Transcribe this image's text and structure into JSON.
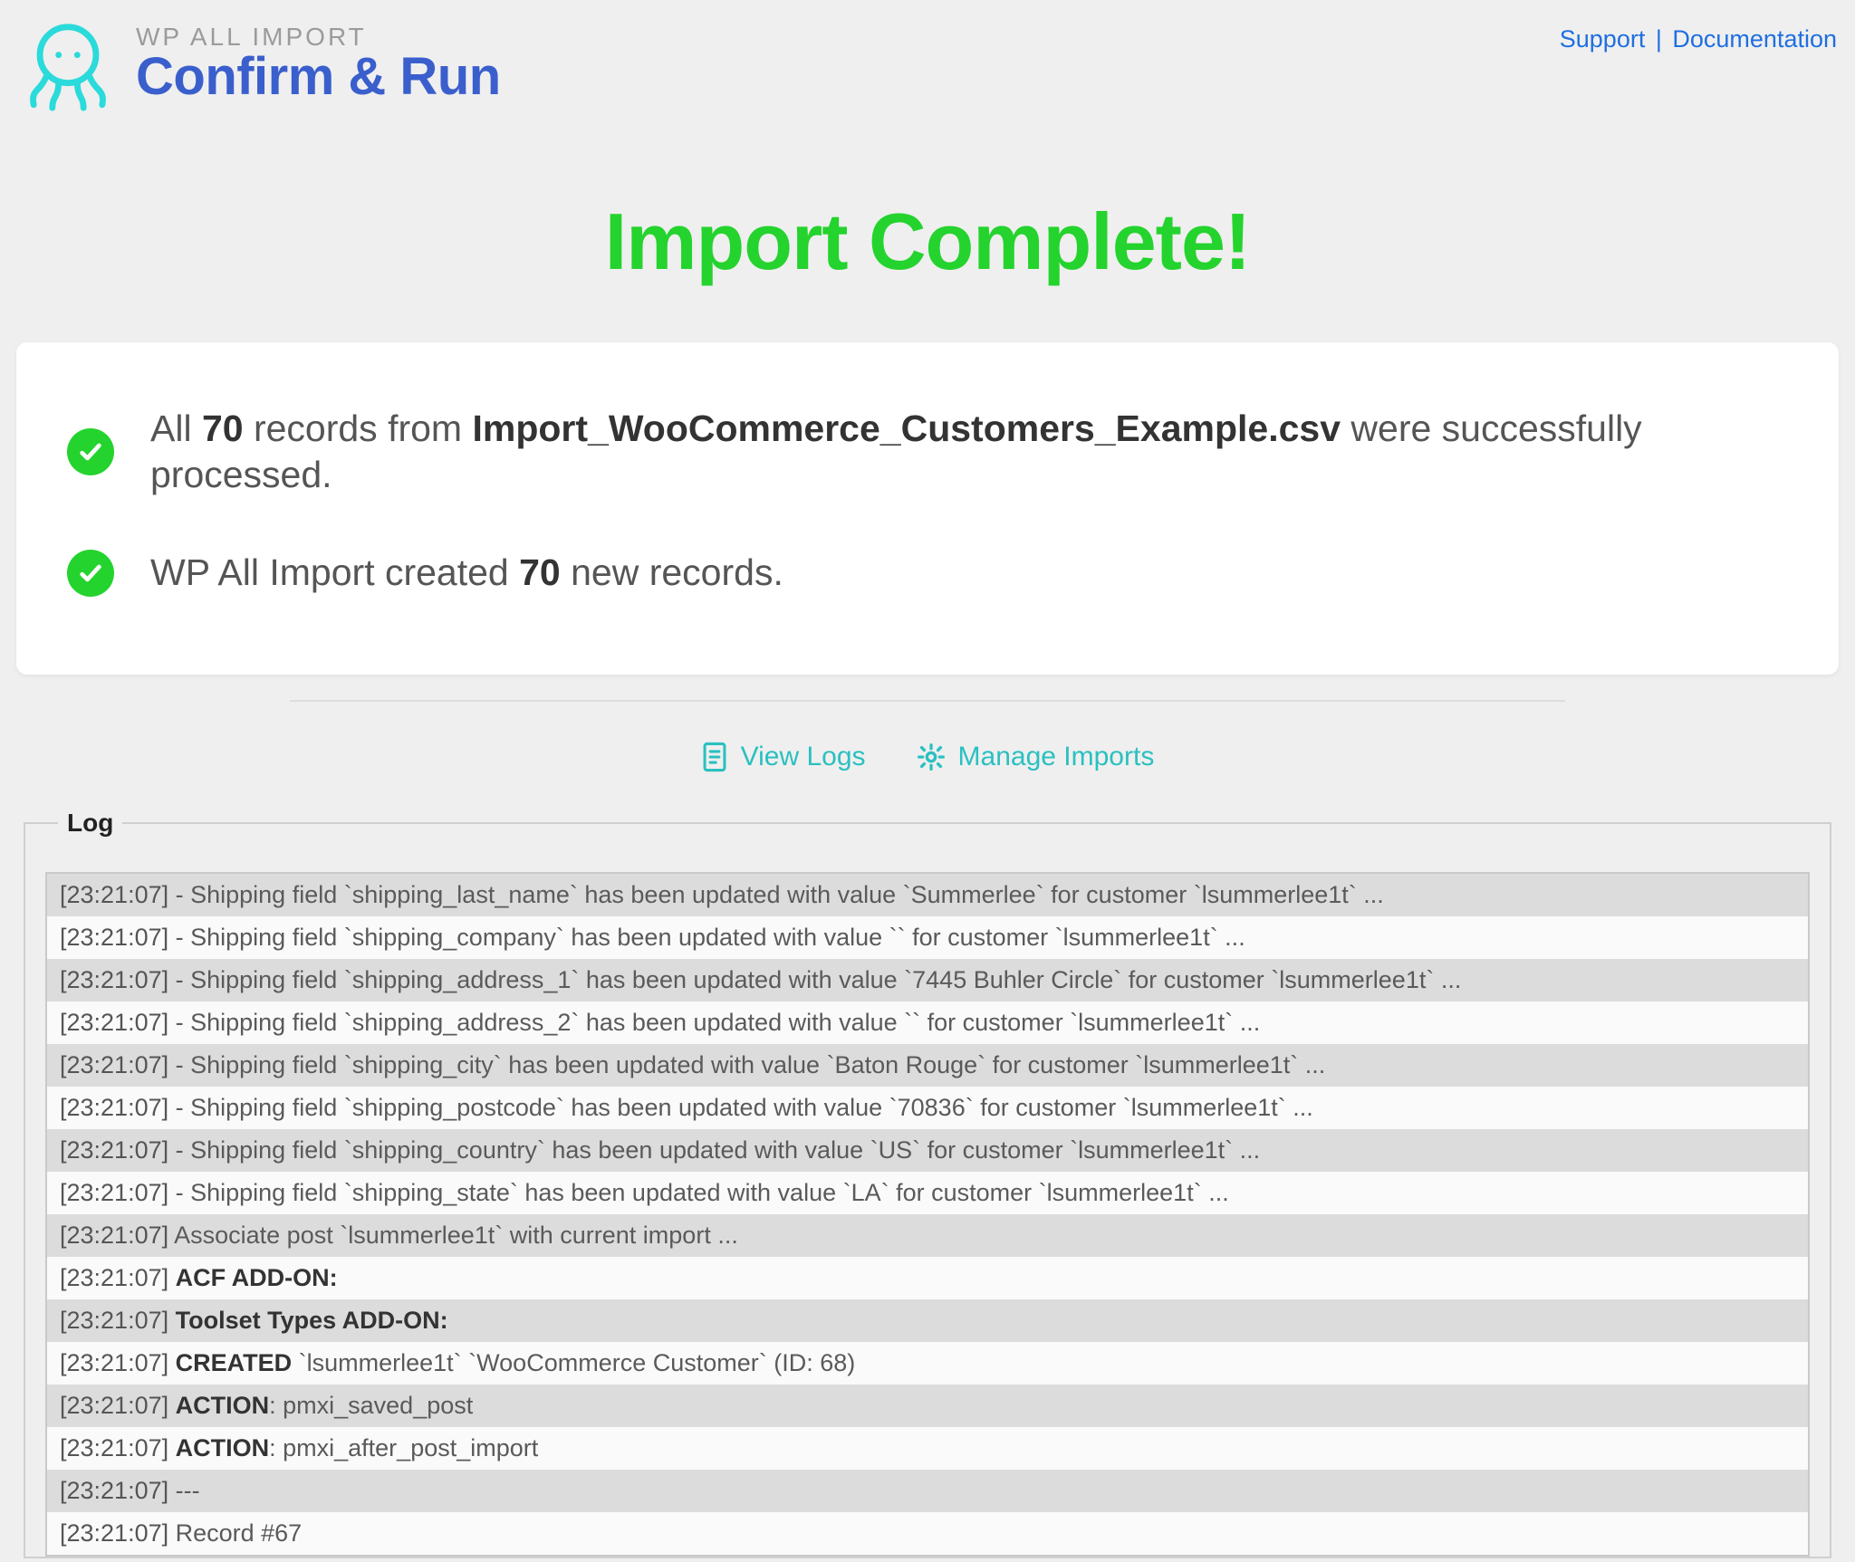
{
  "header": {
    "product": "WP ALL IMPORT",
    "title": "Confirm & Run",
    "links": {
      "support": "Support",
      "documentation": "Documentation"
    }
  },
  "complete_heading": "Import Complete!",
  "summary": {
    "line1": {
      "prefix": "All ",
      "count": "70",
      "mid": " records from ",
      "filename": "Import_WooCommerce_Customers_Example.csv",
      "suffix": " were successfully processed."
    },
    "line2": {
      "prefix": "WP All Import created ",
      "count": "70",
      "suffix": " new records."
    }
  },
  "actions": {
    "view_logs": "View Logs",
    "manage_imports": "Manage Imports"
  },
  "log_legend": "Log",
  "log_ts": "[23:21:07]",
  "log": [
    {
      "html": " - Shipping field `shipping_last_name` has been updated with value `Summerlee` for customer `lsummerlee1t` ..."
    },
    {
      "html": " - Shipping field `shipping_company` has been updated with value `` for customer `lsummerlee1t` ..."
    },
    {
      "html": " - Shipping field `shipping_address_1` has been updated with value `7445 Buhler Circle` for customer `lsummerlee1t` ..."
    },
    {
      "html": " - Shipping field `shipping_address_2` has been updated with value `` for customer `lsummerlee1t` ..."
    },
    {
      "html": " - Shipping field `shipping_city` has been updated with value `Baton Rouge` for customer `lsummerlee1t` ..."
    },
    {
      "html": " - Shipping field `shipping_postcode` has been updated with value `70836` for customer `lsummerlee1t` ..."
    },
    {
      "html": " - Shipping field `shipping_country` has been updated with value `US` for customer `lsummerlee1t` ..."
    },
    {
      "html": " - Shipping field `shipping_state` has been updated with value `LA` for customer `lsummerlee1t` ..."
    },
    {
      "html": " Associate post `lsummerlee1t` with current import ..."
    },
    {
      "html": " <b>ACF ADD-ON:</b>"
    },
    {
      "html": " <b>Toolset Types ADD-ON:</b>"
    },
    {
      "html": " <b>CREATED</b> `lsummerlee1t` `WooCommerce Customer` (ID: 68)"
    },
    {
      "html": " <b>ACTION</b>: pmxi_saved_post"
    },
    {
      "html": " <b>ACTION</b>: pmxi_after_post_import"
    },
    {
      "html": " ---"
    },
    {
      "html": " Record #67"
    }
  ]
}
